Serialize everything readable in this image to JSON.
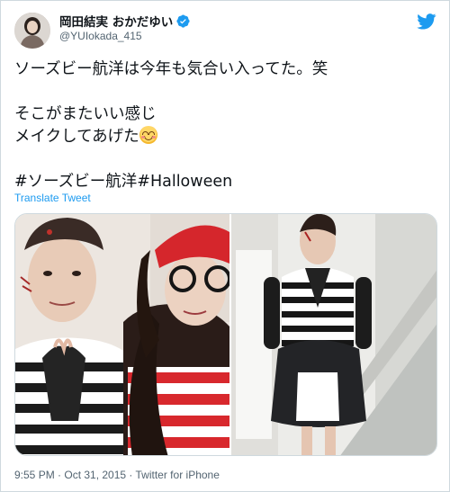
{
  "tweet": {
    "display_name": "岡田結実 おかだゆい",
    "handle": "@YUIokada_415",
    "text_lines": [
      "ソーズビー航洋は今年も気合い入ってた。笑",
      "そこがまたいい感じ",
      "メイクしてあげた"
    ],
    "hashtags": "#ソーズビー航洋#Halloween",
    "translate_label": "Translate Tweet",
    "timestamp": "9:55 PM · Oct 31, 2015 · Twitter for iPhone"
  },
  "icons": {
    "verified": "verified-badge-icon",
    "logo": "twitter-bird-icon",
    "emoji": "smiling-face-blushing-emoji"
  },
  "colors": {
    "link": "#1d9bf0",
    "secondary_text": "#536471",
    "verified": "#1d9bf0",
    "border": "#cfd9de"
  }
}
